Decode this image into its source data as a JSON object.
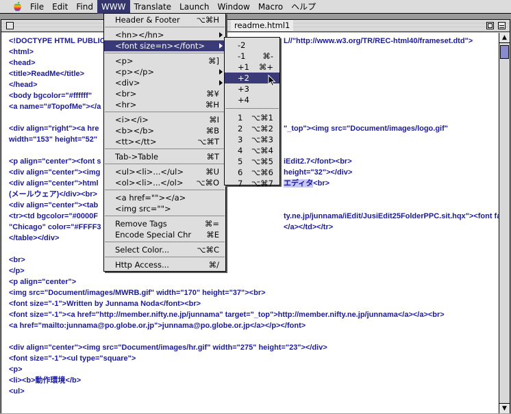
{
  "menubar": {
    "apple_icon": "apple-icon",
    "items": [
      "File",
      "Edit",
      "Find",
      "WWW",
      "Translate",
      "Launch",
      "Window",
      "Macro",
      "ヘルプ"
    ],
    "active": "WWW"
  },
  "window": {
    "title": "readme.html1"
  },
  "code_lines": [
    "<!DOCTYPE HTML PUBLIC",
    "<html>",
    "<head>",
    "<title>ReadMe</title>",
    "</head>",
    "<body bgcolor=\"#ffffff\"",
    "<a name=\"#TopofMe\"></a",
    "",
    "<div align=\"right\"><a hre",
    "width=\"153\" height=\"52\"",
    "",
    "<p align=\"center\"><font s",
    "<div align=\"center\"><img",
    "<div align=\"center\">html",
    "(メールウェア)</div><br>",
    "<div align=\"center\"><tab",
    "<tr><td bgcolor=\"#0000F",
    "\"Chicago\" color=\"#FFFF3",
    "</table></div>",
    "",
    "<br>",
    "</p>",
    "<p align=\"center\">",
    "<img src=\"Document/images/MWRB.gif\" width=\"170\" height=\"37\"><br>",
    "<font size=\"-1\">Written by Junnama Noda</font><br>",
    "<font size=\"-1\"><a href=\"http://member.nifty.ne.jp/junnama\" target=\"_top\">http://member.nifty.ne.jp/junnama</a></a><br>",
    "<a href=\"mailto:junnama@po.globe.or.jp\">junnama@po.globe.or.jp</a></p></font>",
    "",
    "<div align=\"center\"><img src=\"Document/images/hr.gif\" width=\"275\" height=\"23\"></div>",
    "<font size=\"-1\"><ul type=\"square\">",
    "<p>",
    "<li><b>動作環境</b>",
    "<ul>"
  ],
  "code_right_fragments": [
    {
      "line": 0,
      "text": "L//\"http://www.w3.org/TR/REC-html40/frameset.dtd\">"
    },
    {
      "line": 8,
      "text": "\"_top\"><img src=\"Document/images/logo.gif\""
    },
    {
      "line": 11,
      "text": "iEdit2.7</font><br>"
    },
    {
      "line": 12,
      "text": "height=\"32\"></div>"
    },
    {
      "line": 13,
      "text": "エディタ<br>"
    },
    {
      "line": 16,
      "text": "ty.ne.jp/junnama/iEdit/JusiEdit25FolderPPC.sit.hqx\"><font face="
    },
    {
      "line": 17,
      "text": "</a></td></tr>"
    }
  ],
  "www_menu": {
    "items": [
      {
        "label": "Header & Footer",
        "key": "⌥⌘H"
      },
      {
        "sep": true
      },
      {
        "label": "<hn></hn>",
        "submenu": true
      },
      {
        "label": "<font size=n></font>",
        "submenu": true,
        "highlighted": true
      },
      {
        "sep": true
      },
      {
        "label": "<p>",
        "key": "⌘]"
      },
      {
        "label": "<p></p>",
        "submenu": true
      },
      {
        "label": "<div>",
        "submenu": true
      },
      {
        "label": "<br>",
        "key": "⌘¥"
      },
      {
        "label": "<hr>",
        "key": "⌘H"
      },
      {
        "sep": true
      },
      {
        "label": "<i></i>",
        "key": "⌘I"
      },
      {
        "label": "<b></b>",
        "key": "⌘B"
      },
      {
        "label": "<tt></tt>",
        "key": "⌥⌘T"
      },
      {
        "sep": true
      },
      {
        "label": "Tab->Table",
        "key": "⌘T"
      },
      {
        "sep": true
      },
      {
        "label": "<ul><li>...</ul>",
        "key": "⌘U"
      },
      {
        "label": "<ol><li>...</ol>",
        "key": "⌥⌘O"
      },
      {
        "sep": true
      },
      {
        "label": "<a href=\"\"></a>"
      },
      {
        "label": "<img src=\"\">"
      },
      {
        "sep": true
      },
      {
        "label": "Remove Tags",
        "key": "⌘="
      },
      {
        "label": "Encode Special Chr",
        "key": "⌘E"
      },
      {
        "sep": true
      },
      {
        "label": "Select Color...",
        "key": "⌥⌘C"
      },
      {
        "sep": true
      },
      {
        "label": "Http Access...",
        "key": "⌘/"
      }
    ]
  },
  "font_submenu": {
    "items": [
      {
        "label": "-2"
      },
      {
        "label": "-1",
        "key": "⌘-"
      },
      {
        "label": "+1",
        "key": "⌘+"
      },
      {
        "label": "+2",
        "highlighted": true
      },
      {
        "label": "+3"
      },
      {
        "label": "+4"
      },
      {
        "sep": true
      },
      {
        "label": "1",
        "key": "⌥⌘1"
      },
      {
        "label": "2",
        "key": "⌥⌘2"
      },
      {
        "label": "3",
        "key": "⌥⌘3"
      },
      {
        "label": "4",
        "key": "⌥⌘4"
      },
      {
        "label": "5",
        "key": "⌥⌘5"
      },
      {
        "label": "6",
        "key": "⌥⌘6"
      },
      {
        "label": "7",
        "key": "⌥⌘7"
      }
    ]
  },
  "colors": {
    "menu_highlight": "#3a3a78",
    "code_tag": "#1a1a9a",
    "desktop": "#9a9a9a"
  }
}
